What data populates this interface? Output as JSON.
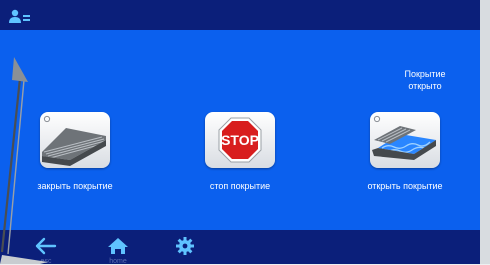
{
  "header": {
    "user_icon": "user-settings-icon"
  },
  "status": {
    "text": "Покрытие\nоткрыто"
  },
  "actions": [
    {
      "label": "закрыть покрытие",
      "icon": "cover-closed-icon"
    },
    {
      "label": "стоп покрытие",
      "icon": "stop-sign-icon",
      "sign_text": "STOP"
    },
    {
      "label": "открыть покрытие",
      "icon": "cover-open-icon"
    }
  ],
  "nav": {
    "back": {
      "label": "esc",
      "icon": "arrow-left-icon"
    },
    "home": {
      "label": "home",
      "icon": "home-icon"
    },
    "settings": {
      "icon": "gear-icon"
    }
  },
  "colors": {
    "screen": "#0b60ee",
    "bars": "#0b1f7a",
    "stop_red": "#d81e1e",
    "water": "#2a86ff"
  }
}
